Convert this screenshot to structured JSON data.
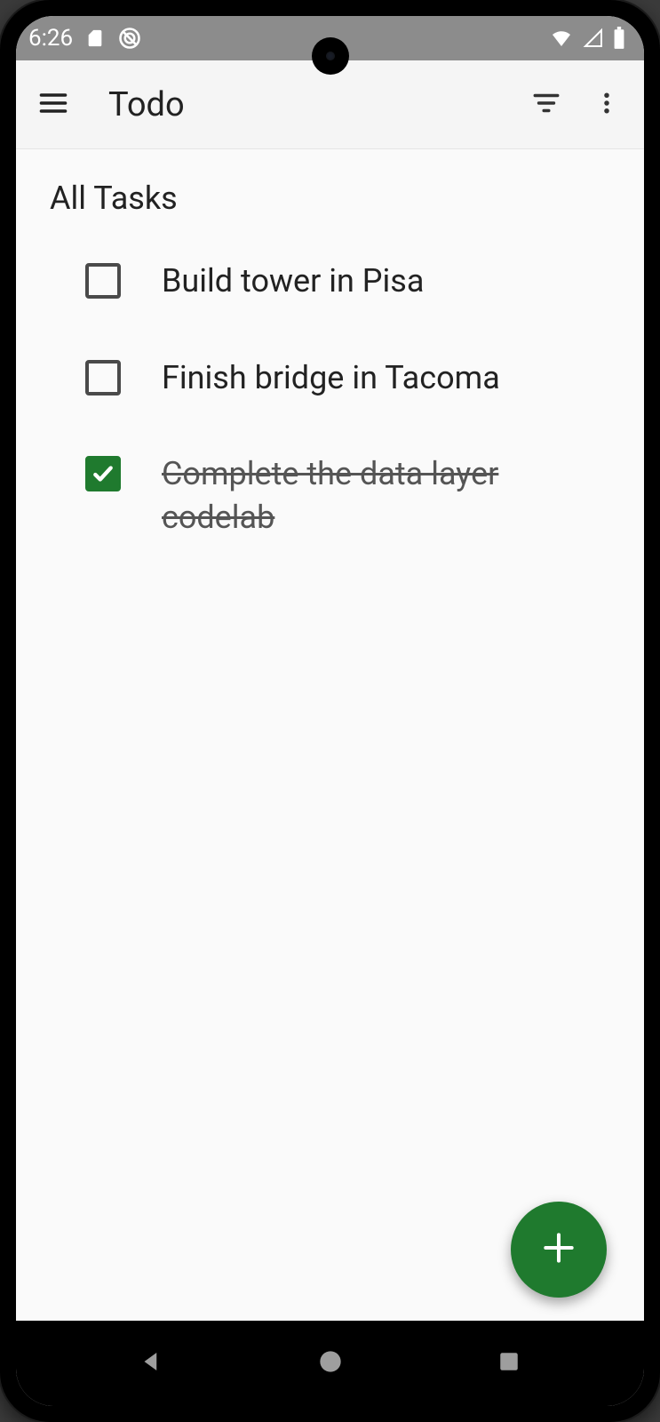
{
  "status": {
    "time": "6:26"
  },
  "appbar": {
    "title": "Todo"
  },
  "section": {
    "title": "All Tasks"
  },
  "tasks": [
    {
      "label": "Build tower in Pisa",
      "done": false
    },
    {
      "label": "Finish bridge in Tacoma",
      "done": false
    },
    {
      "label": "Complete the data layer codelab",
      "done": true
    }
  ],
  "colors": {
    "accent": "#1f7a2e"
  }
}
